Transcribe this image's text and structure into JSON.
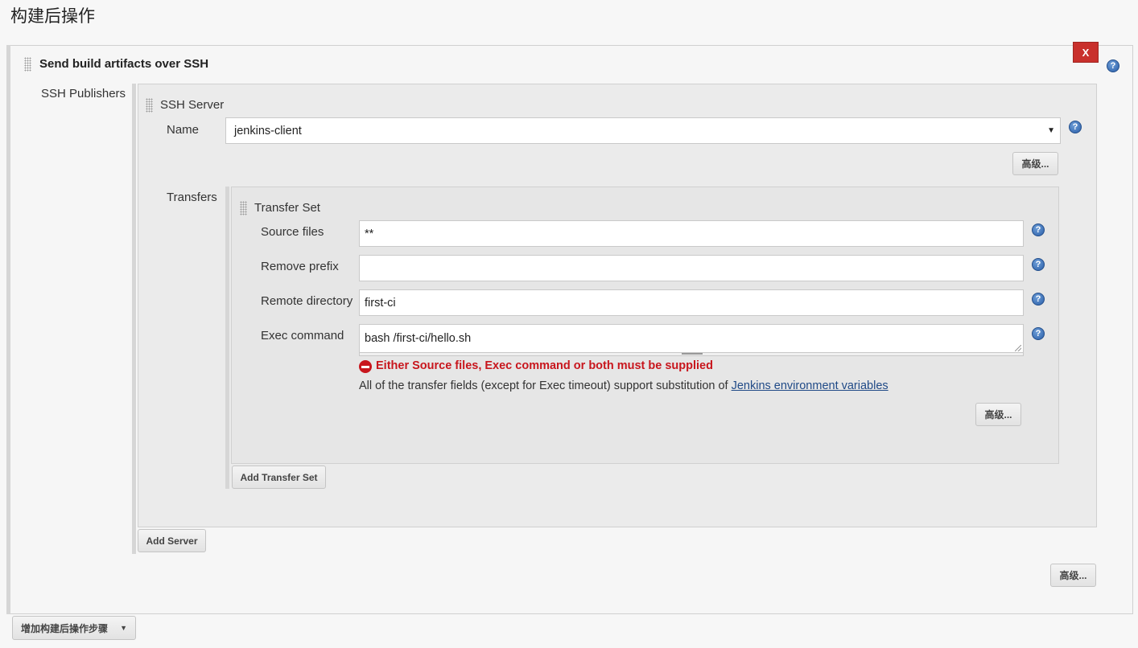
{
  "section": {
    "title": "构建后操作"
  },
  "publisher": {
    "title": "Send build artifacts over SSH",
    "delete_label": "X",
    "advanced_label": "高级..."
  },
  "ssh_publishers": {
    "label": "SSH Publishers",
    "add_server_label": "Add Server"
  },
  "ssh_server": {
    "title": "SSH Server",
    "name_label": "Name",
    "name_value": "jenkins-client",
    "advanced_label": "高级...",
    "transfers_label": "Transfers",
    "add_transfer_set_label": "Add Transfer Set"
  },
  "transfer_set": {
    "title": "Transfer Set",
    "source_files_label": "Source files",
    "source_files_value": "**",
    "remove_prefix_label": "Remove prefix",
    "remove_prefix_value": "",
    "remote_directory_label": "Remote directory",
    "remote_directory_value": "first-ci",
    "exec_command_label": "Exec command",
    "exec_command_value": "bash /first-ci/hello.sh",
    "error_text": "Either Source files, Exec command or both must be supplied",
    "note_prefix": "All of the transfer fields (except for Exec timeout) support substitution of ",
    "note_link": "Jenkins environment variables",
    "advanced_label": "高级..."
  },
  "footer": {
    "add_step_label": "增加构建后操作步骤"
  },
  "icons": {
    "help": "help-icon",
    "grip": "drag-handle-icon",
    "error": "error-icon",
    "dropdown": "chevron-down-icon"
  },
  "colors": {
    "error": "#c8161d",
    "delete_button": "#c9302c",
    "help_icon": "#2a5ea8",
    "link": "#204a87"
  }
}
